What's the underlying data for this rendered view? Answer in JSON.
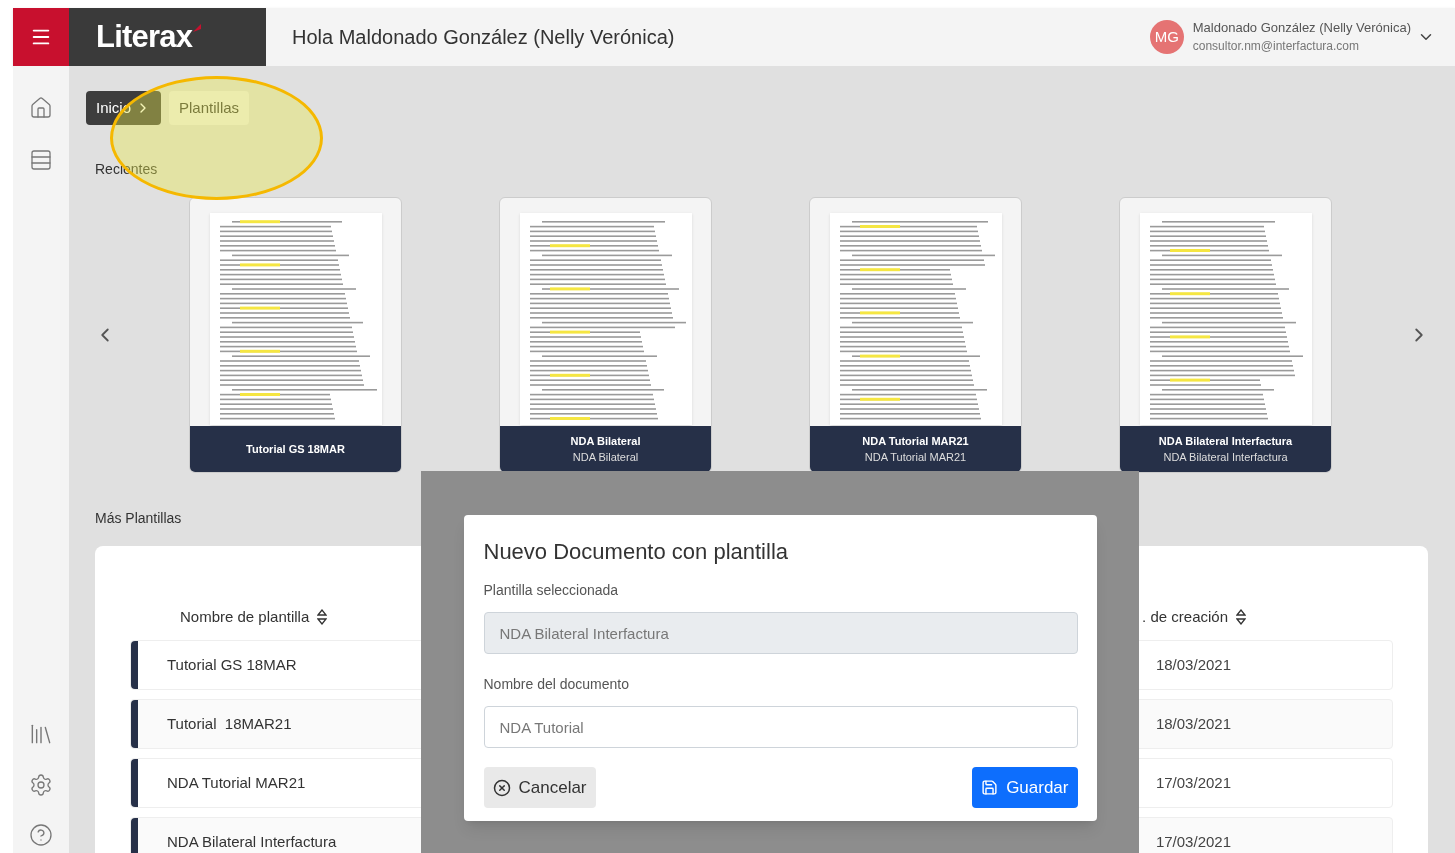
{
  "header": {
    "logo": "Literax",
    "greeting": "Hola Maldonado González (Nelly Verónica)",
    "user": {
      "initials": "MG",
      "name": "Maldonado González (Nelly Verónica)",
      "email": "consultor.nm@interfactura.com"
    }
  },
  "breadcrumb": [
    {
      "label": "Inicio",
      "selected": false
    },
    {
      "label": "Plantillas",
      "selected": true
    }
  ],
  "recent": {
    "title": "Recientes",
    "cards": [
      {
        "title": "Tutorial GS 18MAR"
      },
      {
        "title": "NDA Bilateral",
        "subtitle": "NDA Bilateral"
      },
      {
        "title": "NDA Tutorial MAR21",
        "subtitle": "NDA Tutorial MAR21"
      },
      {
        "title": "NDA Bilateral Interfactura",
        "subtitle": "NDA Bilateral Interfactura"
      }
    ]
  },
  "more": {
    "title": "Más Plantillas",
    "columns": [
      "Nombre de plantilla",
      ". de creación"
    ],
    "rows": [
      {
        "name": "Tutorial GS 18MAR",
        "date": "18/03/2021"
      },
      {
        "name": "Tutorial  18MAR21",
        "date": "18/03/2021"
      },
      {
        "name": "NDA Tutorial MAR21",
        "date": "17/03/2021"
      },
      {
        "name": "NDA Bilateral Interfactura",
        "date": "17/03/2021"
      }
    ]
  },
  "modal": {
    "title": "Nuevo Documento con plantilla",
    "fields": [
      {
        "label": "Plantilla seleccionada",
        "value": "NDA Bilateral Interfactura",
        "disabled": true
      },
      {
        "label": "Nombre del documento",
        "value": "NDA Tutorial",
        "disabled": false
      }
    ],
    "buttons": [
      {
        "label": "Cancelar",
        "kind": "secondary"
      },
      {
        "label": "Guardar",
        "kind": "primary"
      }
    ]
  }
}
